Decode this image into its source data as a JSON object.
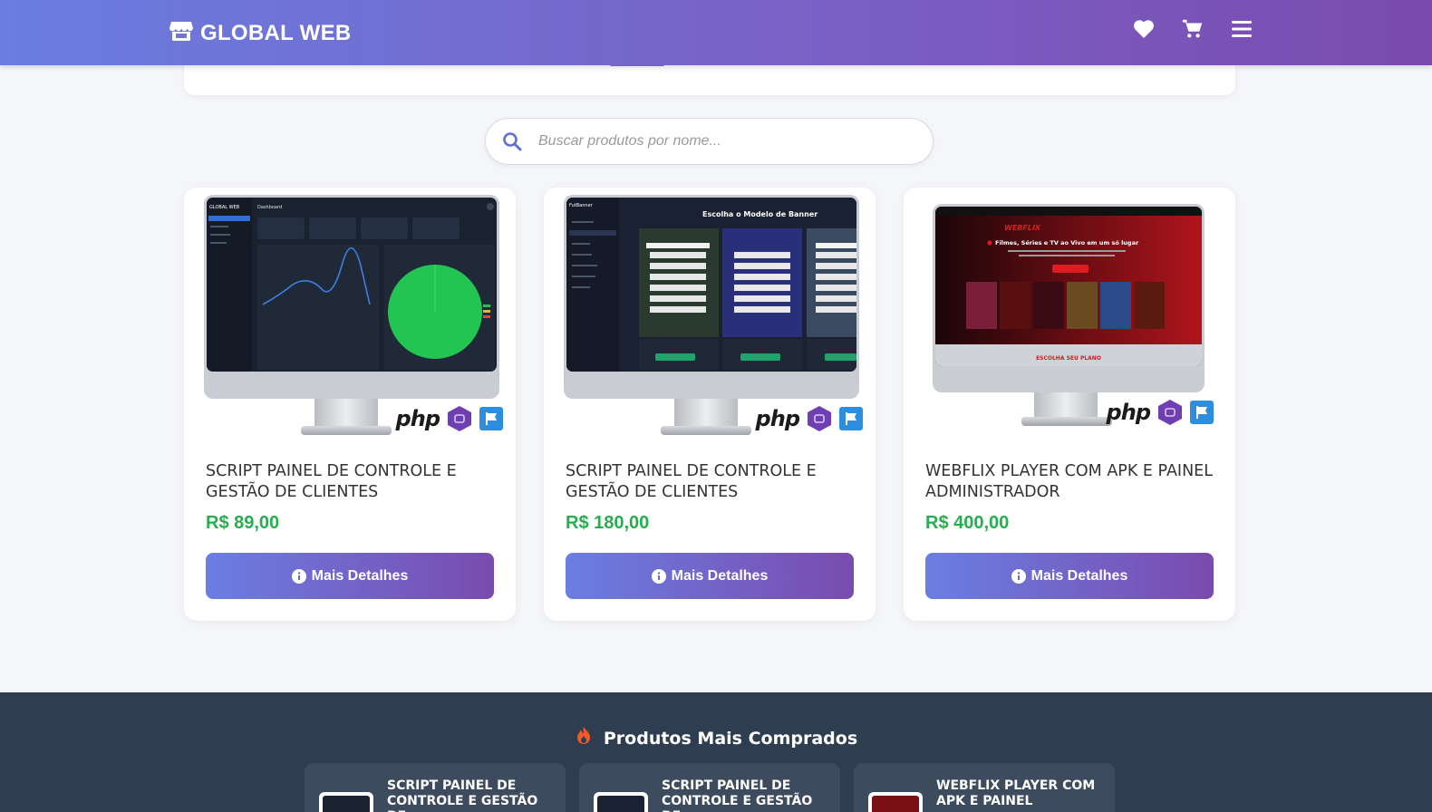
{
  "header": {
    "brand": "GLOBAL WEB",
    "icons": [
      "store-icon",
      "heart-icon",
      "cart-icon",
      "menu-icon"
    ]
  },
  "search": {
    "placeholder": "Buscar produtos por nome..."
  },
  "products": [
    {
      "title": "SCRIPT PAINEL DE CONTROLE E GESTÃO DE CLIENTES",
      "price": "R$ 89,00",
      "button": "Mais Detalhes",
      "image": {
        "brand": "GLOBAL WEB",
        "heading": "Dashboard",
        "badge": "php"
      }
    },
    {
      "title": "SCRIPT PAINEL DE CONTROLE E GESTÃO DE CLIENTES",
      "price": "R$ 180,00",
      "button": "Mais Detalhes",
      "image": {
        "brand": "FutBanner",
        "heading": "Escolha o Modelo de Banner",
        "badge": "php"
      }
    },
    {
      "title": "WEBFLIX PLAYER COM APK E PAINEL ADMINISTRADOR",
      "price": "R$ 400,00",
      "button": "Mais Detalhes",
      "image": {
        "brand": "WEBFLIX",
        "heading": "Filmes, Séries e TV ao Vivo em um só lugar",
        "cta": "ESCOLHA SEU PLANO",
        "badge": "php"
      }
    }
  ],
  "best_sellers": {
    "title": "Produtos Mais Comprados",
    "items": [
      {
        "title": "SCRIPT PAINEL DE CONTROLE E GESTÃO DE"
      },
      {
        "title": "SCRIPT PAINEL DE CONTROLE E GESTÃO DE"
      },
      {
        "title": "WEBFLIX PLAYER COM APK E PAINEL"
      }
    ]
  },
  "colors": {
    "header_start": "#6a7de0",
    "header_end": "#7a4bae",
    "price": "#27ae4f",
    "footer_bg": "#2e3e50"
  }
}
